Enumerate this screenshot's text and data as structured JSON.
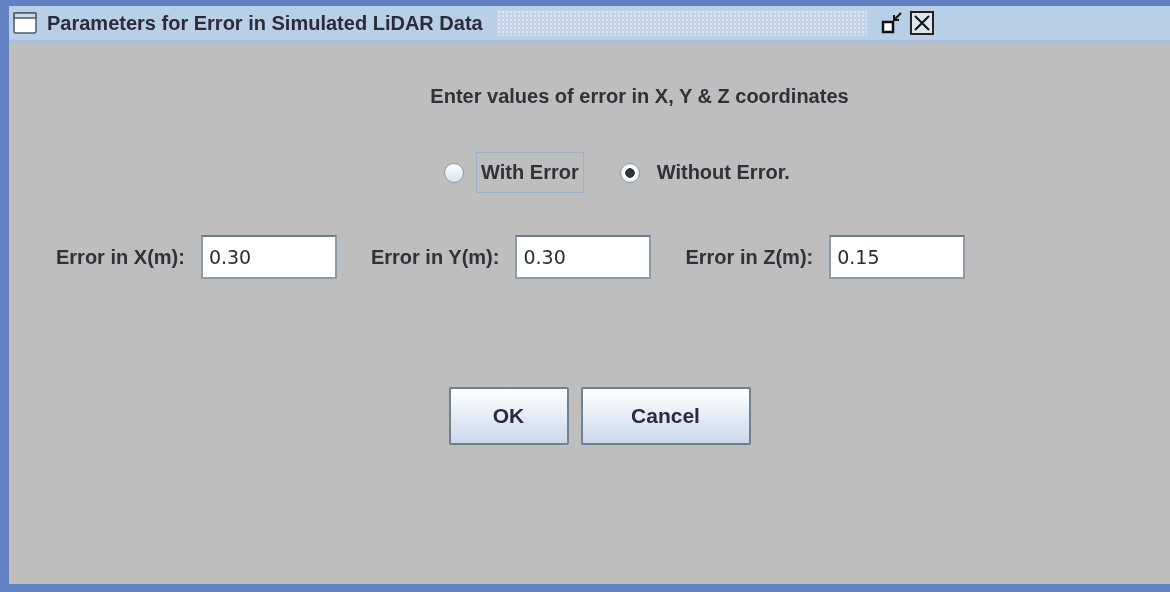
{
  "window": {
    "title": "Parameters for Error in Simulated LiDAR Data"
  },
  "heading": "Enter values of error in X, Y & Z coordinates",
  "radios": [
    {
      "label": "With Error",
      "selected": false,
      "focused": true
    },
    {
      "label": "Without Error.",
      "selected": true,
      "focused": false
    }
  ],
  "fields": [
    {
      "label": "Error in X(m):",
      "value": "0.30"
    },
    {
      "label": "Error in Y(m):",
      "value": "0.30"
    },
    {
      "label": "Error in Z(m):",
      "value": "0.15"
    }
  ],
  "buttons": [
    "OK",
    "Cancel"
  ]
}
